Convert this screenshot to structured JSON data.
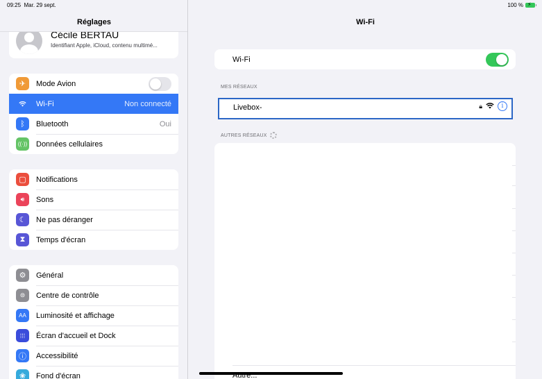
{
  "status": {
    "time": "09:25",
    "date": "Mar. 29 sept.",
    "battery": "100 %"
  },
  "sidebar": {
    "title": "Réglages",
    "profile": {
      "name": "Cécile BERTAU",
      "subtitle": "Identifiant Apple, iCloud, contenu multimé..."
    },
    "group1": [
      {
        "label": "Mode Avion",
        "icon": "airplane-icon",
        "color": "#f09a37",
        "toggle": false
      },
      {
        "label": "Wi-Fi",
        "value": "Non connecté",
        "icon": "wifi-icon",
        "color": "#3478f6",
        "selected": true
      },
      {
        "label": "Bluetooth",
        "value": "Oui",
        "icon": "bluetooth-icon",
        "color": "#3478f6"
      },
      {
        "label": "Données cellulaires",
        "icon": "antenna-icon",
        "color": "#65c466"
      }
    ],
    "group2": [
      {
        "label": "Notifications",
        "icon": "notifications-icon",
        "color": "#eb4e3d"
      },
      {
        "label": "Sons",
        "icon": "speaker-icon",
        "color": "#eb445a"
      },
      {
        "label": "Ne pas déranger",
        "icon": "moon-icon",
        "color": "#5856d6"
      },
      {
        "label": "Temps d'écran",
        "icon": "hourglass-icon",
        "color": "#5856d6"
      }
    ],
    "group3": [
      {
        "label": "Général",
        "icon": "gear-icon",
        "color": "#8e8e93"
      },
      {
        "label": "Centre de contrôle",
        "icon": "toggles-icon",
        "color": "#8e8e93"
      },
      {
        "label": "Luminosité et affichage",
        "icon": "text-size-icon",
        "color": "#3478f6"
      },
      {
        "label": "Écran d'accueil et Dock",
        "icon": "grid-icon",
        "color": "#3a4cdb"
      },
      {
        "label": "Accessibilité",
        "icon": "accessibility-icon",
        "color": "#3478f6"
      },
      {
        "label": "Fond d'écran",
        "icon": "wallpaper-icon",
        "color": "#35aadc"
      }
    ]
  },
  "main": {
    "title": "Wi-Fi",
    "wifi_label": "Wi-Fi",
    "wifi_on": true,
    "my_networks_label": "MES RÉSEAUX",
    "my_network": {
      "name": "Livebox-"
    },
    "other_networks_label": "AUTRES RÉSEAUX",
    "other_label": "Autre..."
  }
}
